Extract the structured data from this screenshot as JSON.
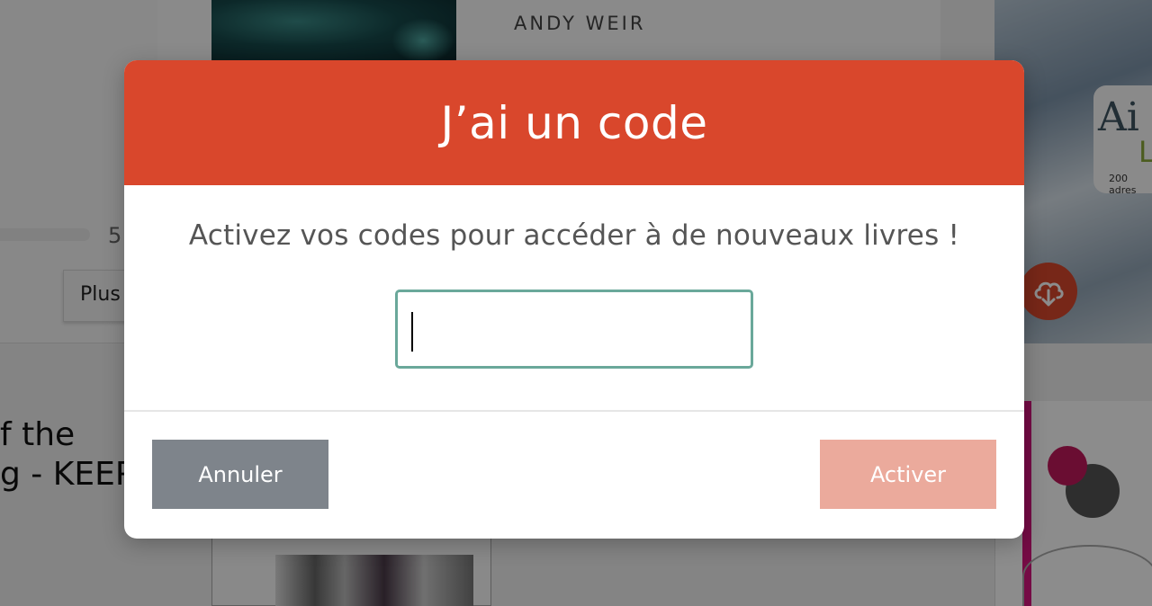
{
  "background": {
    "author": "ANDY WEIR",
    "progress_count": "5",
    "plus_button": "Plus",
    "left_title": "f the\ng - KEEP",
    "right_cover_title": "Ai",
    "right_cover_sub": "Ly",
    "right_cover_small": "200 adres"
  },
  "modal": {
    "title": "J’ai un code",
    "description": "Activez vos codes pour accéder à de nouveaux livres !",
    "code_input": {
      "value": "",
      "placeholder": ""
    },
    "cancel_label": "Annuler",
    "activate_label": "Activer"
  },
  "colors": {
    "header": "#d9472c",
    "cancel": "#7e848b",
    "activate_disabled": "#ebaa9c",
    "input_border": "#6aa89a"
  },
  "icons": {
    "download": "cloud-download-icon"
  }
}
